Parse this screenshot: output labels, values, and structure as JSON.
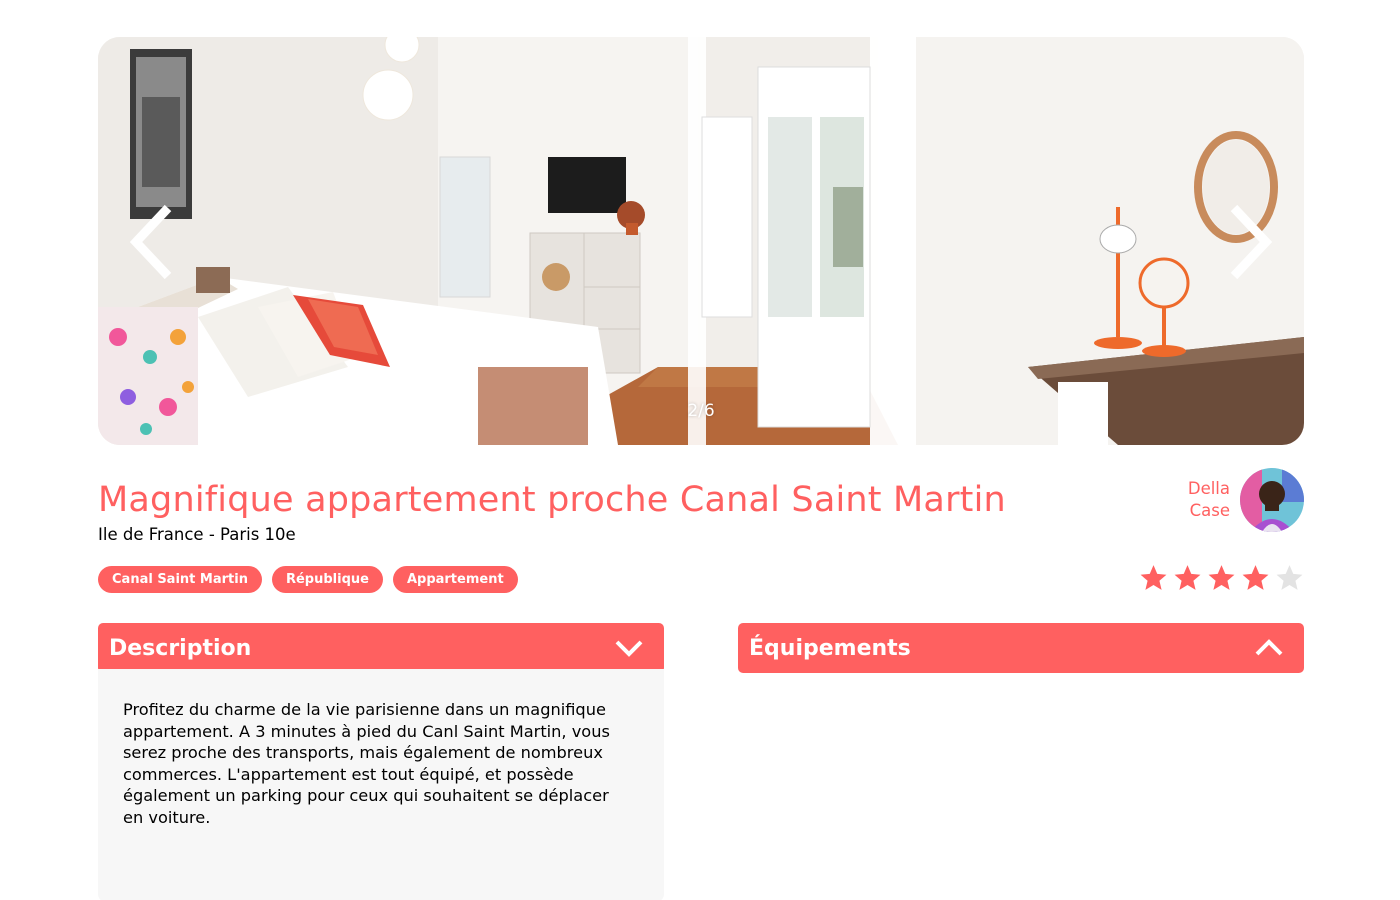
{
  "gallery": {
    "counter": "2/6",
    "prev_icon": "chevron-left-icon",
    "next_icon": "chevron-right-icon"
  },
  "listing": {
    "title": "Magnifique appartement proche Canal Saint Martin",
    "location": "Ile de France - Paris 10e"
  },
  "host": {
    "first_name": "Della",
    "last_name": "Case"
  },
  "tags": [
    "Canal Saint Martin",
    "République",
    "Appartement"
  ],
  "rating": {
    "value": 4,
    "max": 5
  },
  "sections": {
    "description": {
      "title": "Description",
      "icon": "chevron-down-icon",
      "text": "Profitez du charme de la vie parisienne dans un magnifique appartement. A 3 minutes à pied du Canl Saint Martin, vous serez proche des transports, mais également de nombreux commerces. L'appartement est tout équipé, et possède également un parking pour ceux qui souhaitent se déplacer en voiture."
    },
    "equipment": {
      "title": "Équipements",
      "icon": "chevron-up-icon"
    }
  },
  "colors": {
    "accent": "#ff6060",
    "star_empty": "#e3e3e3",
    "panel_bg": "#f7f7f7"
  }
}
